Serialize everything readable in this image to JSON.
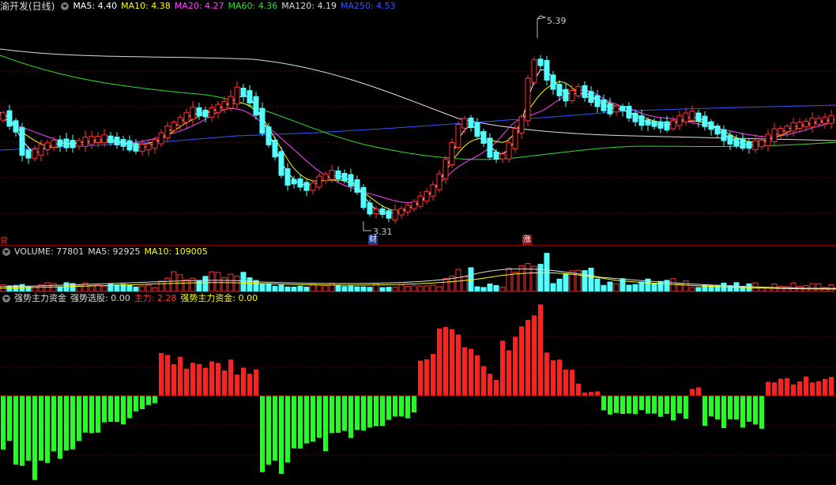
{
  "main": {
    "stock_title": "渝开发(日线)",
    "indicators": [
      {
        "label": "MA5: 4.40",
        "color": "#ffffff"
      },
      {
        "label": "MA10: 4.38",
        "color": "#ffff00"
      },
      {
        "label": "MA20: 4.27",
        "color": "#ff44ff"
      },
      {
        "label": "MA60: 4.36",
        "color": "#33dd33"
      },
      {
        "label": "MA120: 4.19",
        "color": "#dddddd"
      },
      {
        "label": "MA250: 4.53",
        "color": "#3355ff"
      }
    ],
    "high_label": "5.39",
    "low_label": "3.31",
    "marker_cai": "财",
    "marker_zhang": "涨",
    "left_marker": "贷"
  },
  "volume": {
    "indicators": [
      {
        "label": "VOLUME: 77801",
        "color": "#dddddd"
      },
      {
        "label": "MA5: 92925",
        "color": "#dddddd"
      },
      {
        "label": "MA10: 109005",
        "color": "#ffff00"
      }
    ]
  },
  "fund": {
    "indicators": [
      {
        "label": "强势主力资金",
        "color": "#dddddd"
      },
      {
        "label": "强势选股: 0.00",
        "color": "#dddddd"
      },
      {
        "label": "主力: 2.28",
        "color": "#ff3333"
      },
      {
        "label": "强势主力资金: 0.00",
        "color": "#ffff00"
      }
    ]
  },
  "colors": {
    "up": "#ff3333",
    "down": "#54ffff",
    "pos_bar": "#ff2020",
    "neg_bar": "#22ff22",
    "grid": "#6a0000",
    "ma5": "#ffffff",
    "ma10": "#ffff00",
    "ma20": "#ff44ff",
    "ma60": "#33dd33",
    "ma120": "#dddddd",
    "ma250": "#3355ff"
  }
}
